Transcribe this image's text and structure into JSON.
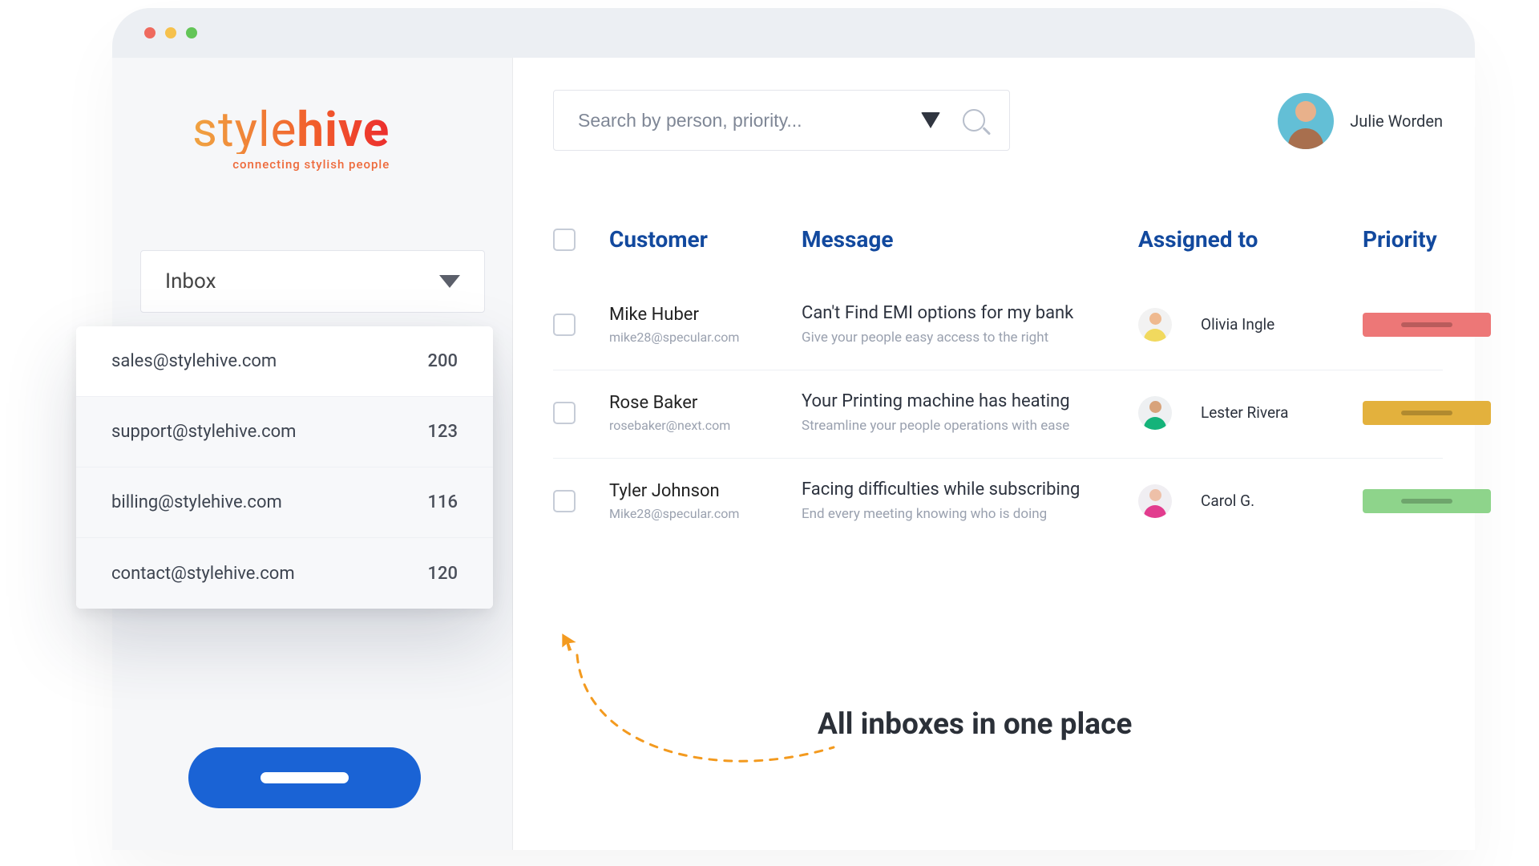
{
  "brand": {
    "name_a": "style",
    "name_b": "hive",
    "tagline": "connecting stylish people"
  },
  "search": {
    "placeholder": "Search by person, priority..."
  },
  "user": {
    "name": "Julie Worden"
  },
  "sidebar": {
    "select_label": "Inbox",
    "inboxes": [
      {
        "address": "sales@stylehive.com",
        "count": "200",
        "selected": true
      },
      {
        "address": "support@stylehive.com",
        "count": "123",
        "selected": false
      },
      {
        "address": "billing@stylehive.com",
        "count": "116",
        "selected": false
      },
      {
        "address": "contact@stylehive.com",
        "count": "120",
        "selected": false
      }
    ]
  },
  "columns": {
    "customer": "Customer",
    "message": "Message",
    "assigned": "Assigned to",
    "priority": "Priority"
  },
  "rows": [
    {
      "customer_name": "Mike Huber",
      "customer_email": "mike28@specular.com",
      "subject": "Can't Find EMI options for my bank",
      "preview": "Give your people easy access to the right",
      "assignee": "Olivia Ingle",
      "priority": "red"
    },
    {
      "customer_name": "Rose Baker",
      "customer_email": "rosebaker@next.com",
      "subject": "Your Printing machine has heating",
      "preview": "Streamline your people operations with ease",
      "assignee": "Lester Rivera",
      "priority": "yel"
    },
    {
      "customer_name": "Tyler Johnson",
      "customer_email": "Mike28@specular.com",
      "subject": "Facing difficulties while subscribing",
      "preview": "End every meeting knowing who is doing",
      "assignee": "Carol G.",
      "priority": "grn"
    }
  ],
  "callout": "All inboxes in one place",
  "colors": {
    "brand_gradient_from": "#f0a442",
    "brand_gradient_to": "#ec2e2e",
    "accent": "#1a63d5",
    "heading": "#12499e",
    "priority_red": "#ed7777",
    "priority_yellow": "#e3b13d",
    "priority_green": "#8ed48b"
  }
}
